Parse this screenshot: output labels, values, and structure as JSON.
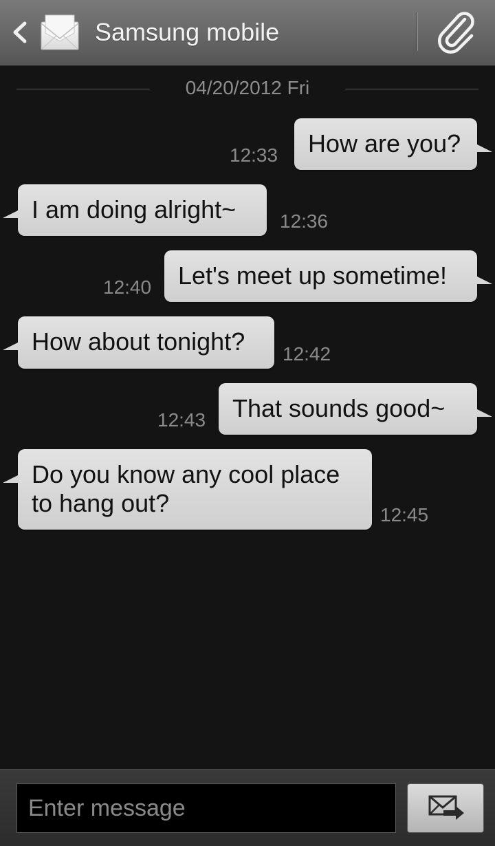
{
  "header": {
    "contact_name": "Samsung mobile",
    "icons": {
      "back": "back-arrow-icon",
      "contact": "envelope-icon",
      "attach": "paperclip-icon"
    }
  },
  "date_separator": "04/20/2012 Fri",
  "messages": [
    {
      "direction": "outgoing",
      "text": "How are you?",
      "time": "12:33"
    },
    {
      "direction": "incoming",
      "text": "I am doing alright~",
      "time": "12:36"
    },
    {
      "direction": "outgoing",
      "text": "Let's meet up sometime!",
      "time": "12:40"
    },
    {
      "direction": "incoming",
      "text": "How about tonight?",
      "time": "12:42"
    },
    {
      "direction": "outgoing",
      "text": "That sounds good~",
      "time": "12:43"
    },
    {
      "direction": "incoming",
      "text": "Do you know any cool place to hang out?",
      "time": "12:45"
    }
  ],
  "compose": {
    "placeholder": "Enter message",
    "value": "",
    "send_icon": "send-message-icon"
  }
}
